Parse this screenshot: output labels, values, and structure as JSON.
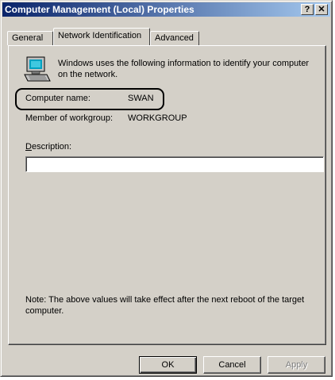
{
  "window": {
    "title": "Computer Management (Local) Properties",
    "help_button": "?",
    "close_button": "✕"
  },
  "tabs": [
    {
      "label": "General",
      "active": false
    },
    {
      "label": "Network Identification",
      "active": true
    },
    {
      "label": "Advanced",
      "active": false
    }
  ],
  "intro": {
    "icon": "computer-icon",
    "text": "Windows uses the following information to identify your computer on the network."
  },
  "fields": {
    "computer_name_label": "Computer name:",
    "computer_name_value": "SWAN",
    "workgroup_label": "Member of workgroup:",
    "workgroup_value": "WORKGROUP",
    "description_label_first": "D",
    "description_label_rest": "escription:",
    "description_value": ""
  },
  "note": "Note: The above values will take effect after the next reboot of the target computer.",
  "buttons": {
    "ok": "OK",
    "cancel": "Cancel",
    "apply": "Apply"
  },
  "colors": {
    "title_gradient_start": "#0a246a",
    "title_gradient_end": "#a6caf0",
    "face": "#d4d0c8"
  }
}
